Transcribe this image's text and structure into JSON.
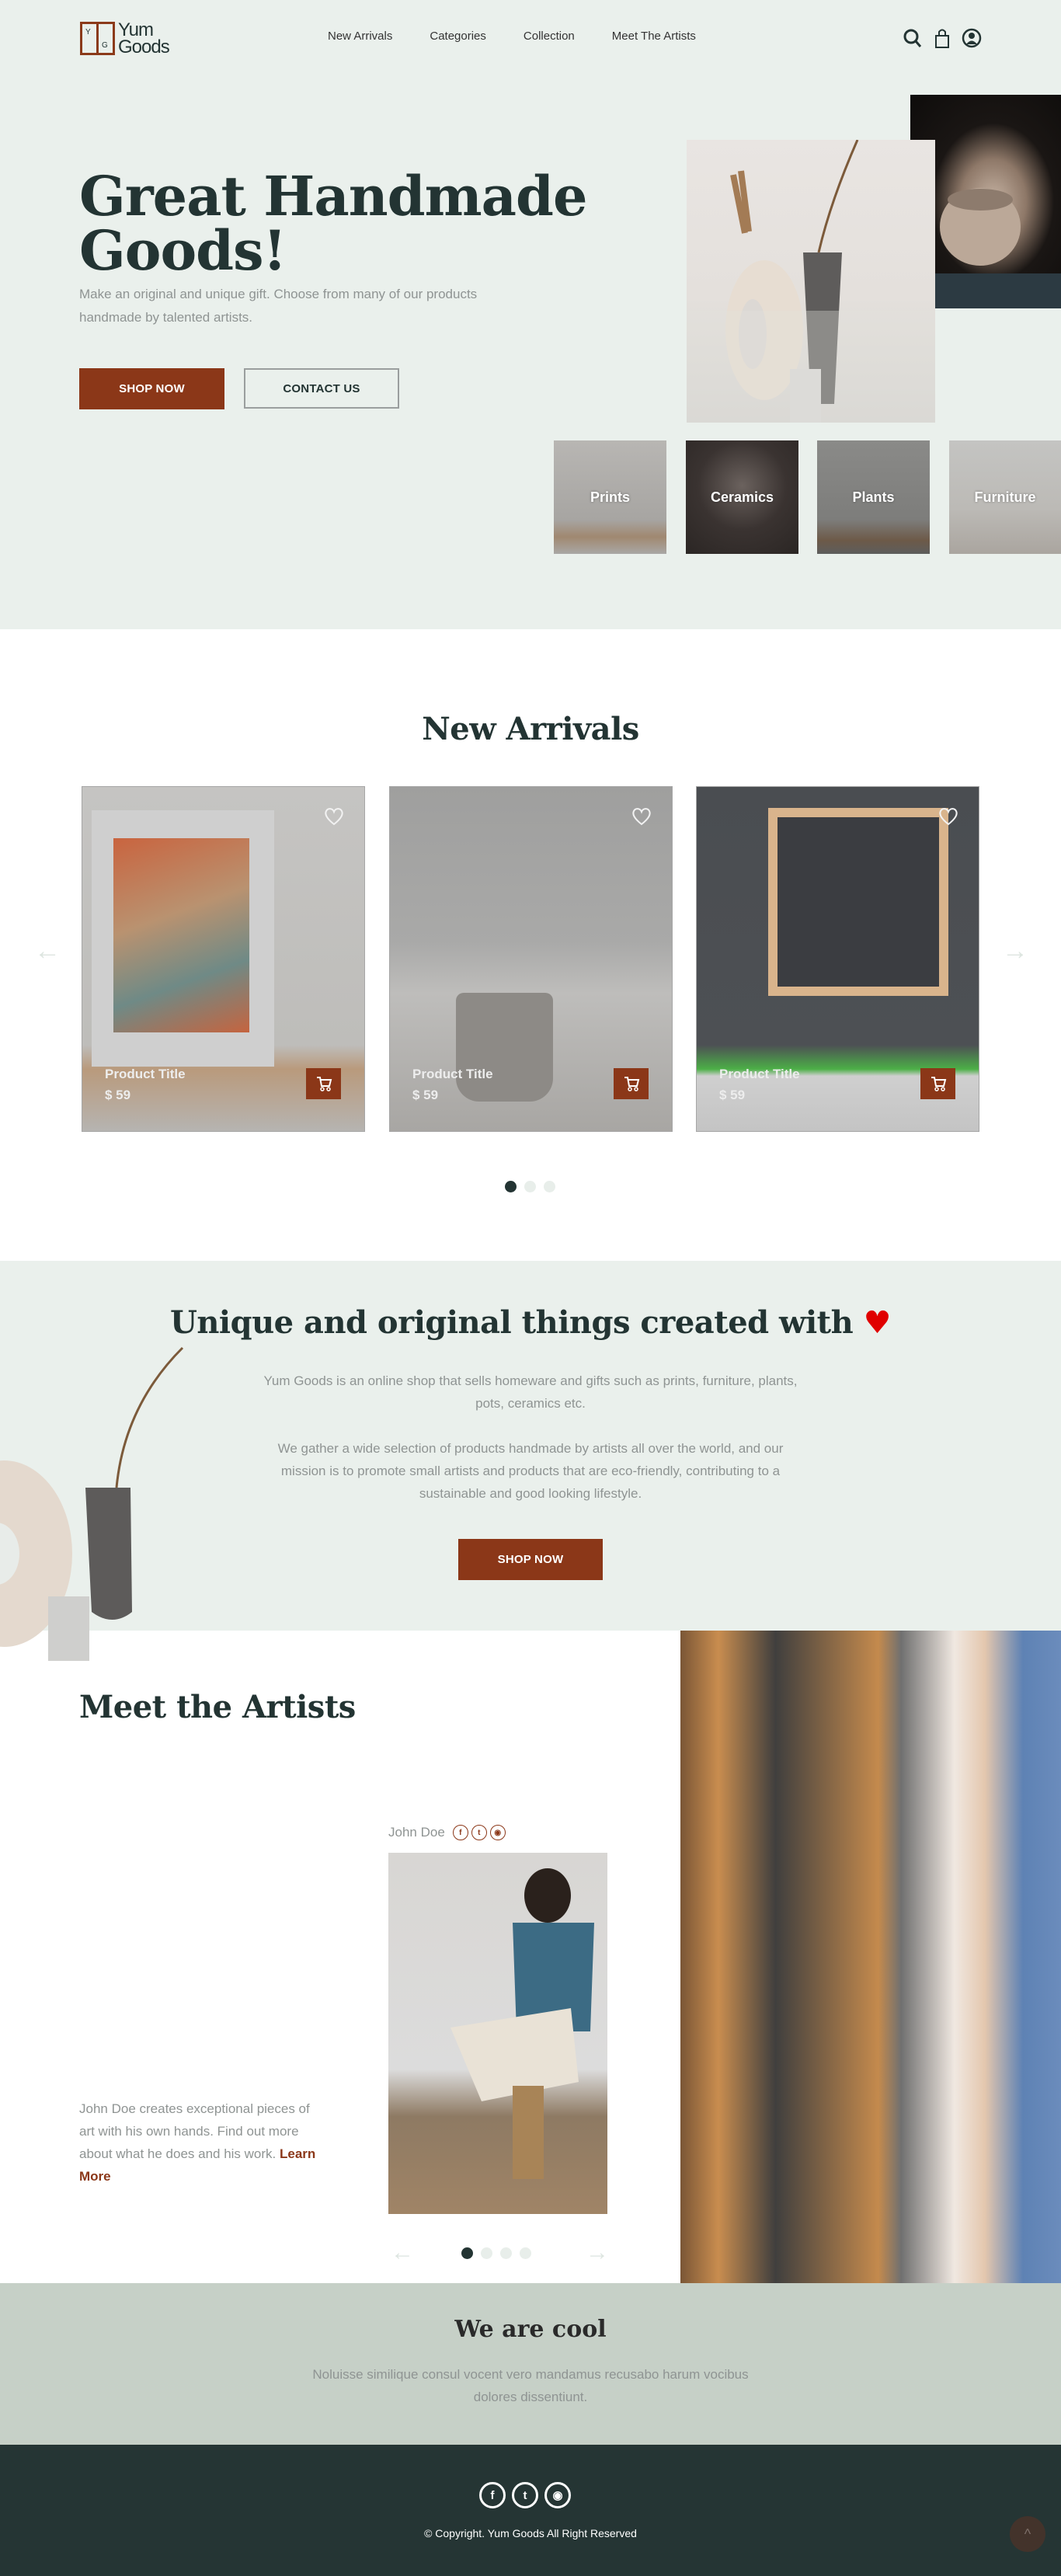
{
  "brand": {
    "logo_letters": [
      "Y",
      "G"
    ],
    "name_line1": "Yum",
    "name_line2": "Goods"
  },
  "nav": {
    "items": [
      "New Arrivals",
      "Categories",
      "Collection",
      "Meet The Artists"
    ]
  },
  "header_icons": [
    "search-icon",
    "shopping-bag-icon",
    "user-account-icon"
  ],
  "hero": {
    "title_line1": "Great Handmade",
    "title_line2": "Goods!",
    "subtitle": "Make an original and unique gift. Choose from many of our products handmade by talented artists.",
    "shop_now": "SHOP NOW",
    "contact_us": "CONTACT US",
    "categories": [
      "Prints",
      "Ceramics",
      "Plants",
      "Furniture"
    ]
  },
  "new_arrivals": {
    "title": "New Arrivals",
    "products": [
      {
        "title": "Product Title",
        "price": "$ 59"
      },
      {
        "title": "Product Title",
        "price": "$ 59"
      },
      {
        "title": "Product Title",
        "price": "$ 59"
      }
    ],
    "dots": 3,
    "active_dot": 0
  },
  "about": {
    "title": "Unique and original things created with",
    "title_icon": "heart-icon",
    "p1": "Yum Goods is an online shop that sells homeware and gifts such as prints, furniture, plants, pots, ceramics etc.",
    "p2": "We gather a wide selection of products handmade by artists all over the world, and our mission is to promote small artists and products that are eco-friendly, contributing to a sustainable and good looking lifestyle.",
    "shop_now": "SHOP NOW"
  },
  "artists": {
    "title": "Meet the Artists",
    "name": "John Doe",
    "social": [
      "facebook-icon",
      "twitter-icon",
      "instagram-icon"
    ],
    "bio": "John Doe creates exceptional pieces of art with his own hands. Find out more about what he does and his work.",
    "learn_more": "Learn More",
    "dots": 4,
    "active_dot": 0
  },
  "cool": {
    "title": "We are cool",
    "text": "Noluisse similique consul vocent vero mandamus recusabo harum vocibus dolores dissentiunt."
  },
  "footer": {
    "social": [
      "facebook-icon",
      "twitter-icon",
      "instagram-icon"
    ],
    "copyright": "© Copyright. Yum Goods All Right Reserved"
  },
  "colors": {
    "accent": "#8b3718",
    "dark": "#233433",
    "mint_bg": "#eaf0ec",
    "sage_bg": "#c6d0c7",
    "footer_bg": "#253534",
    "heart": "#e00000"
  }
}
